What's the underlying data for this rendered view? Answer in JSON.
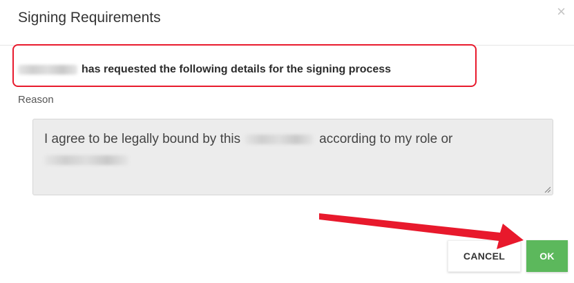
{
  "dialog": {
    "title": "Signing Requirements",
    "close_symbol": "×",
    "request_text": "has requested the following details for the signing process",
    "reason_label": "Reason",
    "reason_text_start": "I agree to be legally bound by this",
    "reason_text_end": "according to my role or",
    "cancel_label": "CANCEL",
    "ok_label": "OK"
  },
  "colors": {
    "highlight_border": "#e8192c",
    "ok_button": "#5cb85c",
    "annotation_arrow": "#e8192c"
  },
  "icons": {
    "close": "close-icon",
    "resize": "resize-grip-icon",
    "annotation": "red-arrow-annotation"
  }
}
